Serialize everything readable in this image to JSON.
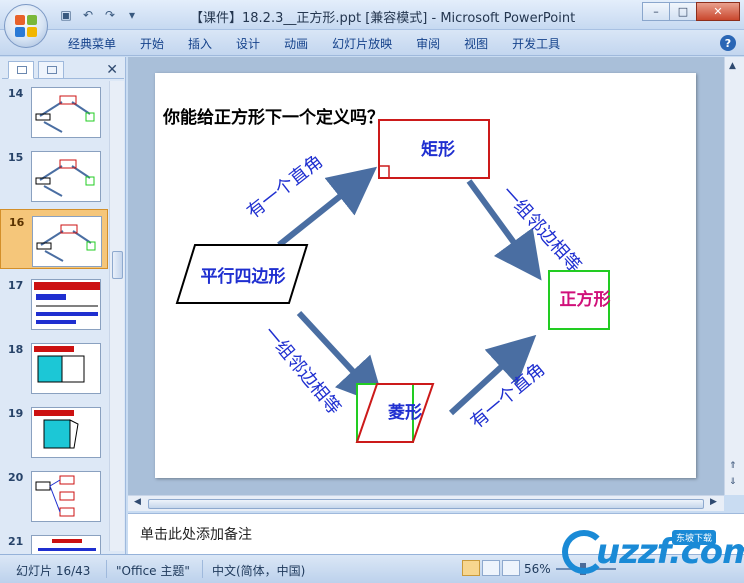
{
  "window": {
    "title": "【课件】18.2.3__正方形.ppt [兼容模式] - Microsoft PowerPoint",
    "buttons": {
      "minimize": "–",
      "maximize": "□",
      "close": "✕"
    }
  },
  "ribbon": {
    "tabs": [
      "经典菜单",
      "开始",
      "插入",
      "设计",
      "动画",
      "幻灯片放映",
      "审阅",
      "视图",
      "开发工具"
    ],
    "help": "?"
  },
  "slides_panel": {
    "thumbnails": [
      {
        "num": "14"
      },
      {
        "num": "15"
      },
      {
        "num": "16",
        "active": true
      },
      {
        "num": "17"
      },
      {
        "num": "18"
      },
      {
        "num": "19"
      },
      {
        "num": "20"
      },
      {
        "num": "21"
      }
    ]
  },
  "slide": {
    "question": "你能给正方形下一个定义吗？",
    "parallelogram_label": "平行四边形",
    "rectangle_label": "矩形",
    "rhombus_label": "菱形",
    "square_label": "正方形",
    "edge_top_left": "有一个直角",
    "edge_top_right": "一组邻边相等",
    "edge_bottom_left": "一组邻边相等",
    "edge_bottom_right": "有一个直角",
    "colors": {
      "arrow": "#4a6ea2",
      "edge_text": "#1f2fd0",
      "rect": "#cc1a1a",
      "square": "#22cc22",
      "square_text": "#d0107a"
    }
  },
  "notes": {
    "placeholder": "单击此处添加备注"
  },
  "status": {
    "slide_count": "幻灯片 16/43",
    "theme": "\"Office 主题\"",
    "language": "中文(简体，中国)",
    "zoom": "56%"
  },
  "watermark": {
    "text": "uzzf.com",
    "badge": "东坡下载"
  }
}
